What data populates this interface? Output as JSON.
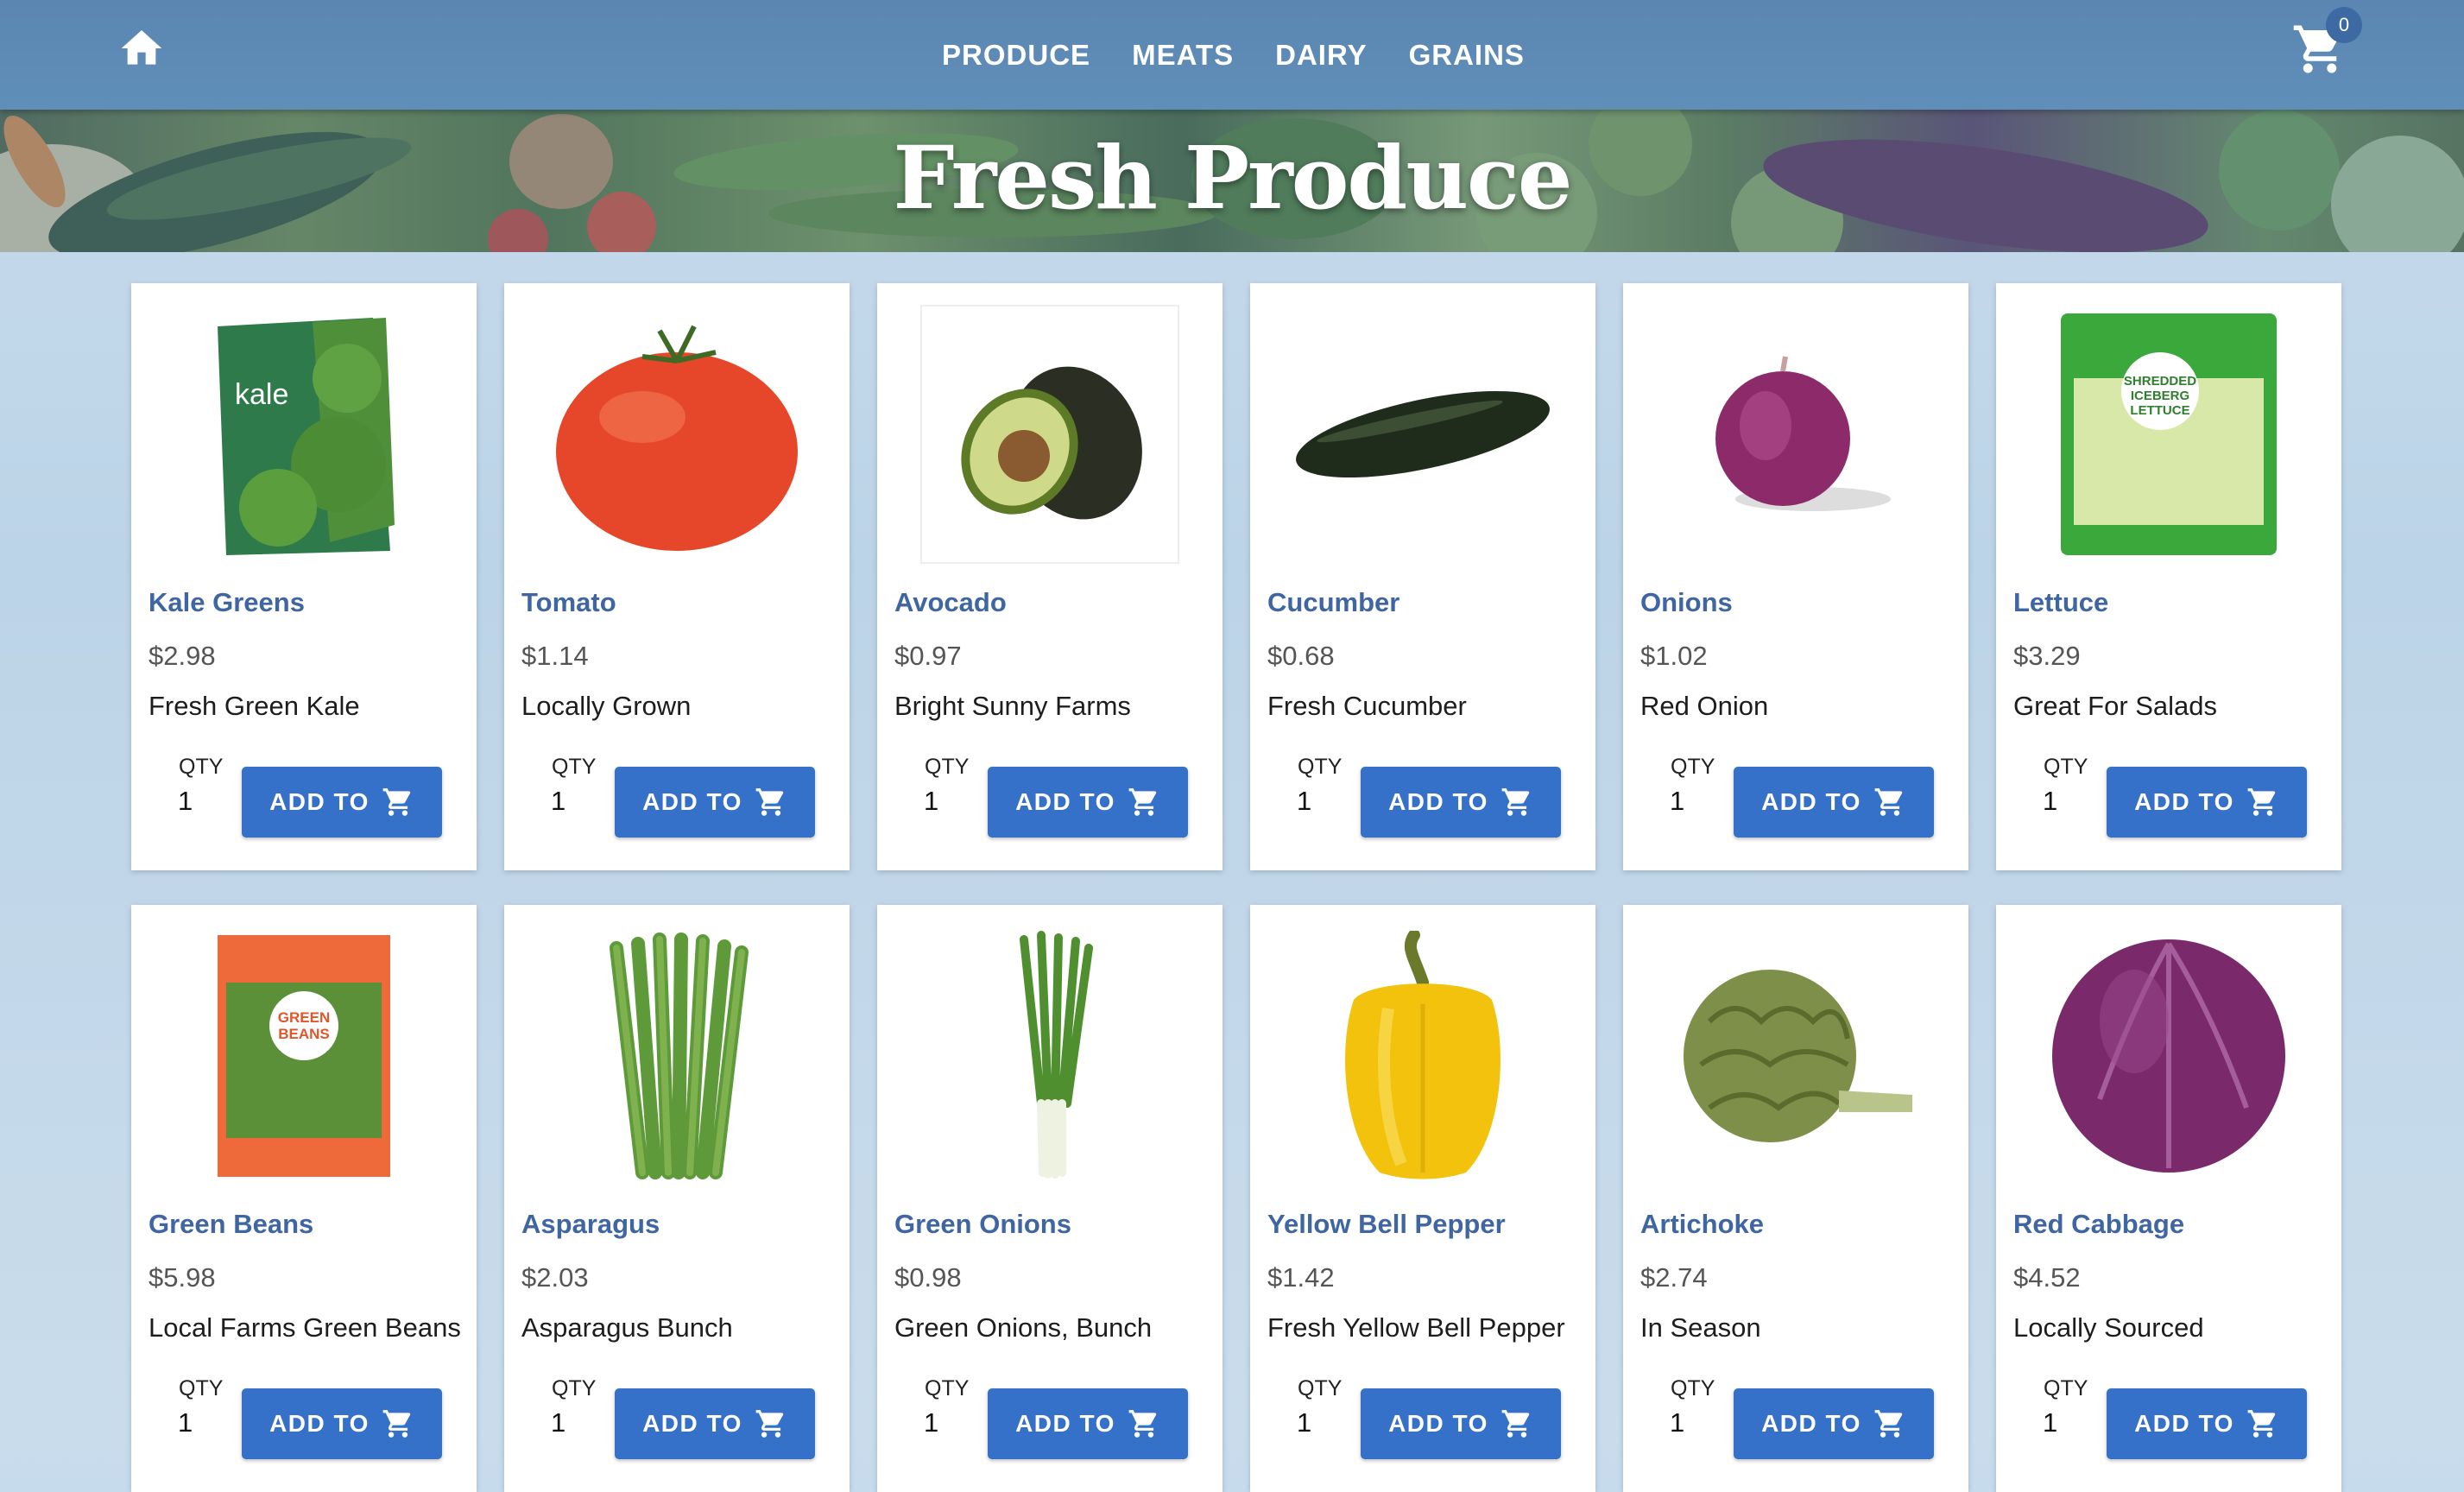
{
  "nav": {
    "links": [
      "PRODUCE",
      "MEATS",
      "DAIRY",
      "GRAINS"
    ],
    "cart_count": "0",
    "home_icon": "home-icon",
    "cart_icon": "cart-icon"
  },
  "hero": {
    "title": "Fresh Produce"
  },
  "colors": {
    "nav": "#5b86b2",
    "button": "#3570c9",
    "product_name": "#3f66a3"
  },
  "products": [
    {
      "name": "Kale Greens",
      "price": "$2.98",
      "desc": "Fresh Green Kale",
      "qty_label": "QTY",
      "qty": "1",
      "btn": "ADD TO",
      "image": "kale-bag",
      "pkg_text": "kale"
    },
    {
      "name": "Tomato",
      "price": "$1.14",
      "desc": "Locally Grown",
      "qty_label": "QTY",
      "qty": "1",
      "btn": "ADD TO",
      "image": "tomato"
    },
    {
      "name": "Avocado",
      "price": "$0.97",
      "desc": "Bright Sunny Farms",
      "qty_label": "QTY",
      "qty": "1",
      "btn": "ADD TO",
      "image": "avocado"
    },
    {
      "name": "Cucumber",
      "price": "$0.68",
      "desc": "Fresh Cucumber",
      "qty_label": "QTY",
      "qty": "1",
      "btn": "ADD TO",
      "image": "cucumber"
    },
    {
      "name": "Onions",
      "price": "$1.02",
      "desc": "Red Onion",
      "qty_label": "QTY",
      "qty": "1",
      "btn": "ADD TO",
      "image": "red-onion"
    },
    {
      "name": "Lettuce",
      "price": "$3.29",
      "desc": "Great For Salads",
      "qty_label": "QTY",
      "qty": "1",
      "btn": "ADD TO",
      "image": "lettuce-bag",
      "pkg_text": "SHREDDED ICEBERG LETTUCE"
    },
    {
      "name": "Green Beans",
      "price": "$5.98",
      "desc": "Local Farms Green Beans",
      "qty_label": "QTY",
      "qty": "1",
      "btn": "ADD TO",
      "image": "green-beans-bag",
      "pkg_text": "GREEN BEANS"
    },
    {
      "name": "Asparagus",
      "price": "$2.03",
      "desc": "Asparagus Bunch",
      "qty_label": "QTY",
      "qty": "1",
      "btn": "ADD TO",
      "image": "asparagus"
    },
    {
      "name": "Green Onions",
      "price": "$0.98",
      "desc": "Green Onions, Bunch",
      "qty_label": "QTY",
      "qty": "1",
      "btn": "ADD TO",
      "image": "green-onions"
    },
    {
      "name": "Yellow Bell Pepper",
      "price": "$1.42",
      "desc": "Fresh Yellow Bell Pepper",
      "qty_label": "QTY",
      "qty": "1",
      "btn": "ADD TO",
      "image": "yellow-pepper"
    },
    {
      "name": "Artichoke",
      "price": "$2.74",
      "desc": "In Season",
      "qty_label": "QTY",
      "qty": "1",
      "btn": "ADD TO",
      "image": "artichoke"
    },
    {
      "name": "Red Cabbage",
      "price": "$4.52",
      "desc": "Locally Sourced",
      "qty_label": "QTY",
      "qty": "1",
      "btn": "ADD TO",
      "image": "red-cabbage"
    }
  ]
}
